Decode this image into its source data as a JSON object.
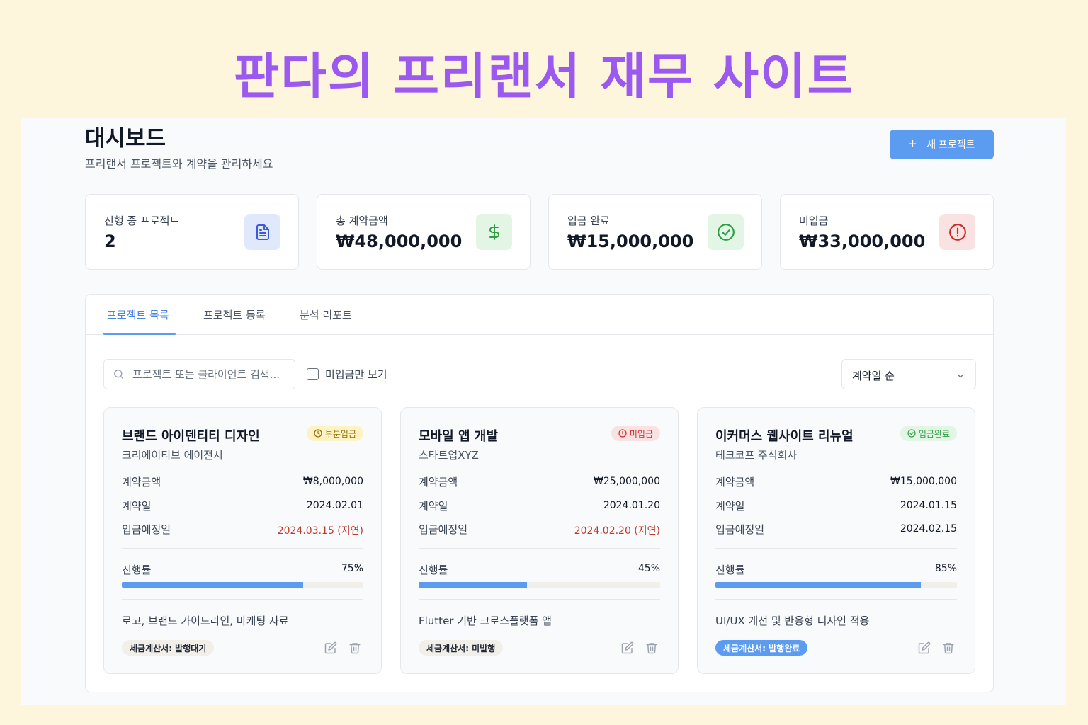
{
  "banner": {
    "title": "판다의 프리랜서 재무 사이트"
  },
  "header": {
    "title": "대시보드",
    "subtitle": "프리랜서 프로젝트와 계약을 관리하세요",
    "new_project_label": "새 프로젝트"
  },
  "stats": [
    {
      "label": "진행 중 프로젝트",
      "value": "2",
      "icon": "document-icon",
      "color": "#3b5bdb",
      "bg": "#e0e8fb"
    },
    {
      "label": "총 계약금액",
      "value": "₩48,000,000",
      "icon": "dollar-icon",
      "color": "#2f9e44",
      "bg": "#e3f6e6"
    },
    {
      "label": "입금 완료",
      "value": "₩15,000,000",
      "icon": "check-circle-icon",
      "color": "#2f9e44",
      "bg": "#e3f6e6"
    },
    {
      "label": "미입금",
      "value": "₩33,000,000",
      "icon": "alert-circle-icon",
      "color": "#c92a2a",
      "bg": "#fbe2e2"
    }
  ],
  "tabs": [
    {
      "label": "프로젝트 목록",
      "active": true
    },
    {
      "label": "프로젝트 등록",
      "active": false
    },
    {
      "label": "분석 리포트",
      "active": false
    }
  ],
  "filters": {
    "search_placeholder": "프로젝트 또는 클라이언트 검색...",
    "unpaid_only_label": "미입금만 보기",
    "unpaid_only_checked": false,
    "sort_value": "계약일 순"
  },
  "field_labels": {
    "amount": "계약금액",
    "contract_date": "계약일",
    "due_date": "입금예정일",
    "progress": "진행률"
  },
  "projects": [
    {
      "title": "브랜드 아이덴티티 디자인",
      "client": "크리에이티브 에이전시",
      "status": "부분입금",
      "status_icon": "clock-icon",
      "status_color": "#9a6b00",
      "status_bg": "#fdf3c4",
      "amount": "₩8,000,000",
      "contract_date": "2024.02.01",
      "due_date": "2024.03.15 (지연)",
      "late": true,
      "progress_text": "75%",
      "progress": 0.75,
      "description": "로고, 브랜드 가이드라인, 마케팅 자료",
      "tax_invoice": "세금계산서: 발행대기",
      "tax_done": false
    },
    {
      "title": "모바일 앱 개발",
      "client": "스타트업XYZ",
      "status": "미입금",
      "status_icon": "alert-circle-icon",
      "status_color": "#c92a2a",
      "status_bg": "#fbe2e2",
      "amount": "₩25,000,000",
      "contract_date": "2024.01.20",
      "due_date": "2024.02.20 (지연)",
      "late": true,
      "progress_text": "45%",
      "progress": 0.45,
      "description": "Flutter 기반 크로스플랫폼 앱",
      "tax_invoice": "세금계산서: 미발행",
      "tax_done": false
    },
    {
      "title": "이커머스 웹사이트 리뉴얼",
      "client": "테크코프 주식회사",
      "status": "입금완료",
      "status_icon": "check-circle-icon",
      "status_color": "#2f9e44",
      "status_bg": "#e3f6e6",
      "amount": "₩15,000,000",
      "contract_date": "2024.01.15",
      "due_date": "2024.02.15",
      "late": false,
      "progress_text": "85%",
      "progress": 0.85,
      "description": "UI/UX 개선 및 반응형 디자인 적용",
      "tax_invoice": "세금계산서: 발행완료",
      "tax_done": true
    }
  ],
  "colors": {
    "accent": "#5b9cf0",
    "banner": "#9b59f0",
    "background": "#fdf6dd"
  }
}
